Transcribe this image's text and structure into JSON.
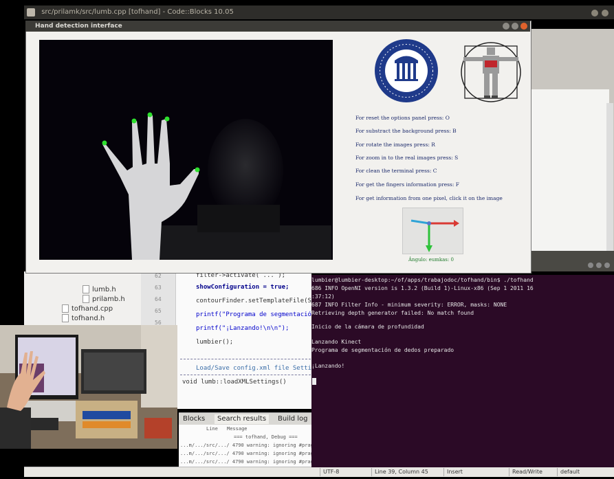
{
  "ide": {
    "title": "src/prilamk/src/lumb.cpp [tofhand] - Code::Blocks 10.05",
    "files": [
      "lumb.h",
      "prilamb.h",
      "tofhand.cpp",
      "tofhand.h"
    ],
    "line_numbers": [
      "62",
      "63",
      "64",
      "65",
      "56",
      "57",
      "58"
    ],
    "code": [
      "filter->activate( ... );",
      "showConfiguration = true;",
      "contourFinder.setTemplateFile(Slamp",
      "printf(\"Programa de segmentación de",
      "printf(\"¡Lanzando!\\n\\n\");",
      "lumbier();"
    ],
    "comment_line": "Load/Save config.xml file Settings",
    "func_line": "void lumb::loadXMLSettings()",
    "tabs": [
      "Blocks",
      "Search results",
      "Build log"
    ],
    "log_header": [
      "Line",
      "Message"
    ],
    "log_lines": [
      "=== tofhand, Debug ===",
      "...m/.../src/.../  4790  warning: ignoring #pragma warning",
      "...m/.../src/.../  4790  warning: ignoring #pragma warning",
      "...m/.../src/.../  4790  warning: ignoring #pragma warning"
    ],
    "status": {
      "encoding": "UTF-8",
      "position": "Line 39, Column 45",
      "mode": "Insert",
      "access": "Read/Write",
      "profile": "default"
    }
  },
  "terminal": {
    "lines": [
      "lumbier@lumbier-desktop:~/of/apps/trabajodoc/tofhand/bin$ ./tofhand",
      "       686 INFO       OpenNI version is 1.3.2 (Build 1)-Linux-x86 (Sep  1 2011 16",
      ":37:12)",
      "       687 INFO       Filter Info - minimum severity: ERROR, masks: NONE",
      "Retrieving depth generator failed: No match found",
      "",
      "Inicio de la cámara de profundidad",
      "",
      "Lanzando Kinect",
      "Programa de segmentación de dedos preparado",
      "",
      "¡Lanzando!"
    ]
  },
  "hand_window": {
    "title": "Hand detection interface",
    "instructions": [
      "For reset the options panel press: O",
      "For substract the background press: B",
      "For rotate the images press: R",
      "For zoom in to the real images press: S",
      "For clean the terminal press: C",
      "For get the fingers information press: F",
      "For get information from one pixel, click it on the image"
    ],
    "axes_caption": "Ángulo: eumkas: 0"
  },
  "colors": {
    "terminal_bg": "#2b0a26",
    "fingertip": "#2ee02e",
    "instruction_text": "#1c2a6b",
    "titlebar": "#3c3b37"
  }
}
